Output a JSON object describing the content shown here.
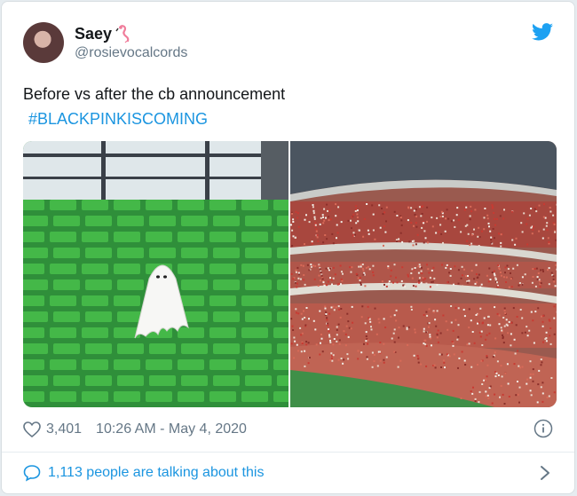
{
  "author": {
    "display_name": "Saey",
    "handle": "@rosievocalcords",
    "avatar_icon": "profile-avatar",
    "badge_icon": "flamingo-icon"
  },
  "tweet": {
    "text": "Before vs after the cb announcement",
    "hashtag": "#BLACKPINKISCOMING"
  },
  "media": {
    "left_image": "ghost-in-empty-green-stadium-seats",
    "right_image": "crowded-stadium-stands"
  },
  "meta": {
    "likes": "3,401",
    "timestamp": "10:26 AM - May 4, 2020"
  },
  "footer": {
    "talking": "1,113 people are talking about this"
  },
  "colors": {
    "link": "#1b95e0",
    "secondary_text": "#657786",
    "seat_green": "#3fae3f"
  }
}
